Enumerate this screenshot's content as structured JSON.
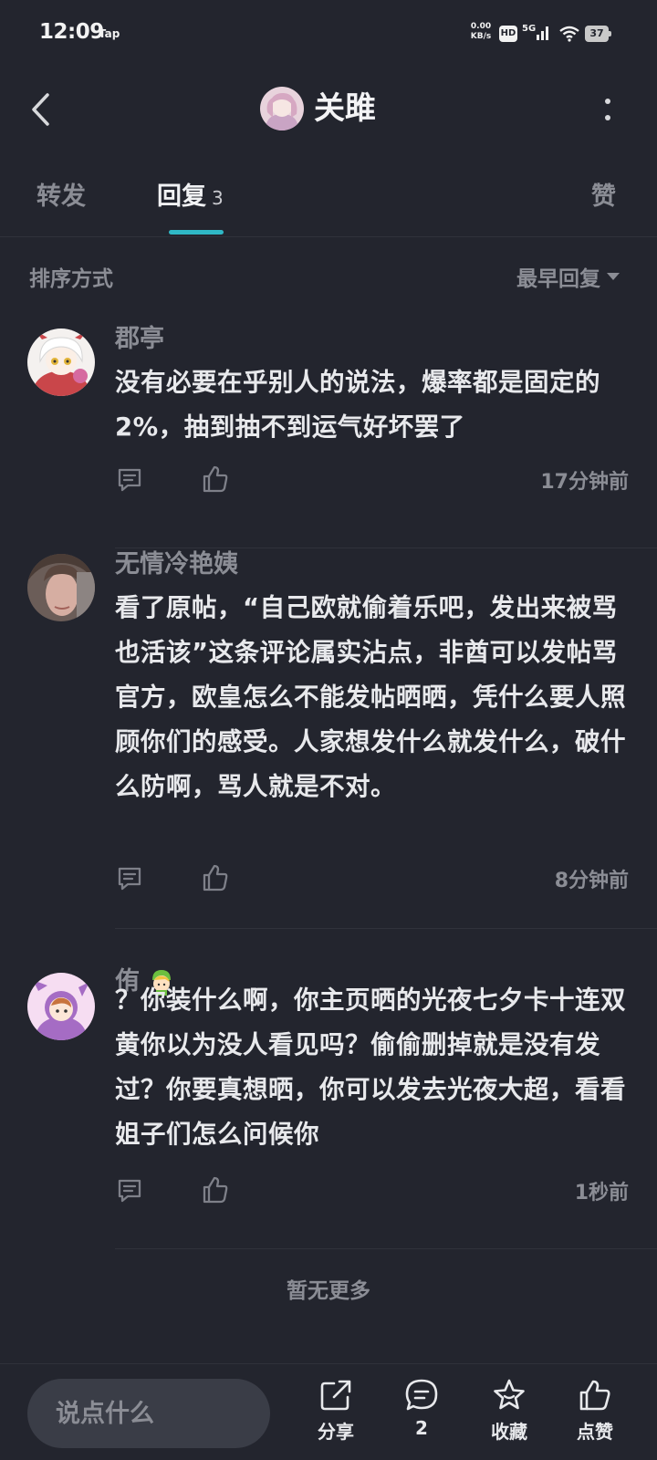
{
  "status_bar": {
    "time": "12:09",
    "app_indicator": "Tap",
    "net_speed_value": "0.00",
    "net_speed_unit": "KB/s",
    "hd_badge": "HD",
    "signal_label": "5G",
    "battery": "37"
  },
  "header": {
    "title": "关雎",
    "back_icon": "chevron-left-icon",
    "more_icon": "more-vertical-icon"
  },
  "tabs": {
    "forward": "转发",
    "reply": "回复",
    "reply_count": "3",
    "like": "赞"
  },
  "sort": {
    "label": "排序方式",
    "value": "最早回复"
  },
  "comments": [
    {
      "name": "郡亭",
      "text": "没有必要在乎别人的说法，爆率都是固定的2%，抽到抽不到运气好坏罢了",
      "time": "17分钟前"
    },
    {
      "name": "无情冷艳姨",
      "text": "看了原帖，“自己欧就偷着乐吧，发出来被骂也活该”这条评论属实沾点，非酋可以发帖骂官方，欧皇怎么不能发帖晒晒，凭什么要人照顾你们的感受。人家想发什么就发什么，破什么防啊，骂人就是不对。",
      "time": "8分钟前"
    },
    {
      "name": "侑",
      "text": "？你装什么啊，你主页晒的光夜七夕卡十连双黄你以为没人看见吗？偷偷删掉就是没有发过？你要真想晒，你可以发去光夜大超，看看姐子们怎么问候你",
      "time": "1秒前"
    }
  ],
  "footer_text": "暂无更多",
  "bottom_bar": {
    "input_placeholder": "说点什么",
    "share_label": "分享",
    "comment_count": "2",
    "collect_label": "收藏",
    "like_label": "点赞"
  },
  "colors": {
    "background": "#23252e",
    "accent": "#2fb8c6",
    "muted_text": "#8b8d95"
  }
}
